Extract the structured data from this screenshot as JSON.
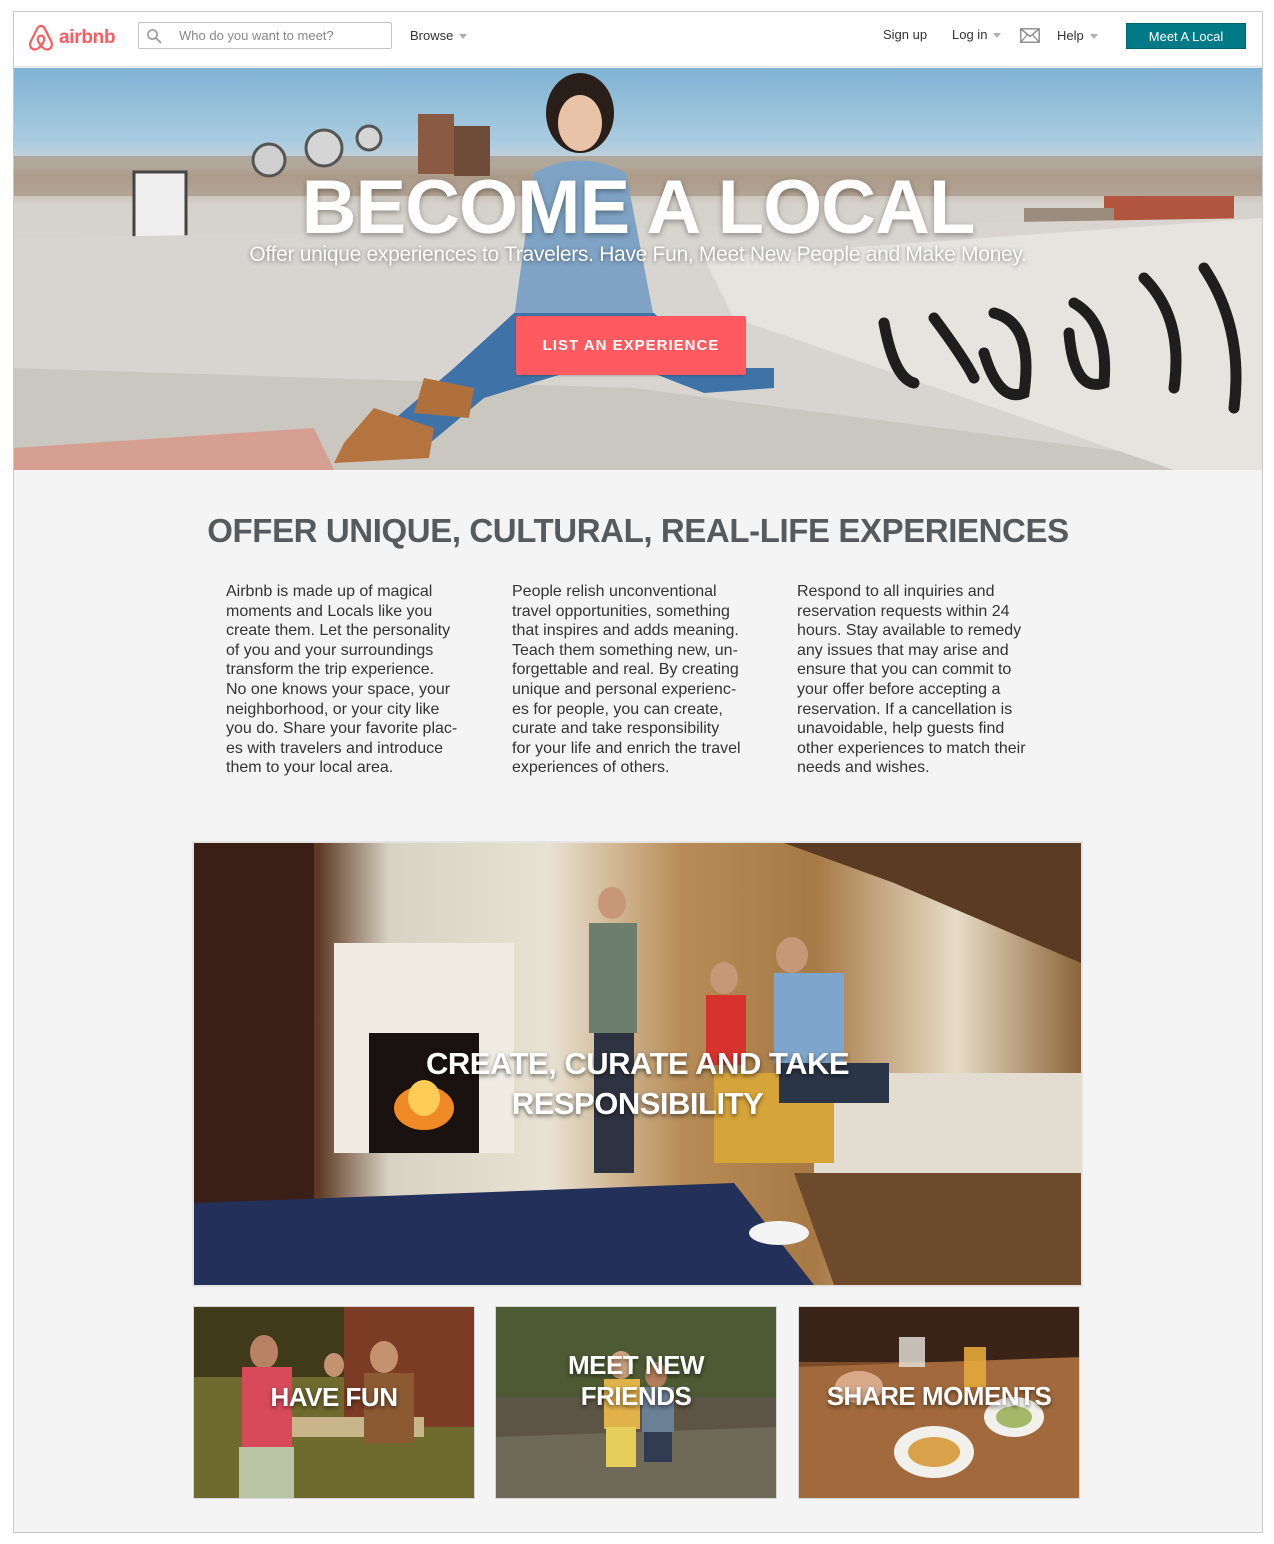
{
  "header": {
    "brand": "airbnb",
    "search": {
      "placeholder": "Who do you want to meet?",
      "value": ""
    },
    "browse_label": "Browse",
    "signup_label": "Sign up",
    "login_label": "Log in",
    "help_label": "Help",
    "cta_label": "Meet A Local",
    "colors": {
      "brand": "#ff5a5f",
      "cta": "#007a87"
    },
    "icons": [
      "airbnb-logo-icon",
      "search-icon",
      "chevron-down-icon",
      "mail-icon"
    ]
  },
  "hero": {
    "title": "BECOME A LOCAL",
    "subtitle": "Offer unique experiences to Travelers. Have Fun, Meet New People and Make Money.",
    "button_label": "LIST AN EXPERIENCE",
    "button_color": "#ff5a5f"
  },
  "intro": {
    "title": "OFFER UNIQUE, CULTURAL, REAL-LIFE EXPERIENCES",
    "columns": [
      "Airbnb is made up of magical\nmoments and Locals like you\ncreate them. Let the personality\nof you and your surroundings\ntransform the trip experience.\nNo one knows your space, your\nneighborhood, or your city like\nyou do. Share your favorite plac-\nes with travelers and introduce\nthem to your local area.",
      "People relish unconventional\ntravel opportunities, something\nthat inspires and adds meaning.\nTeach them something new, un-\nforgettable and real. By creating\nunique and personal experienc-\nes for people, you can create,\ncurate and take responsibility\nfor your life and enrich the travel\nexperiences of others.",
      "Respond to all inquiries and\nreservation requests within 24\nhours. Stay available to remedy\nany issues that may arise and\nensure that you can commit to\nyour offer before accepting a\nreservation. If a cancellation is\nunavoidable, help guests find\nother experiences to match their\nneeds and wishes."
    ]
  },
  "features": {
    "main": "CREATE, CURATE AND TAKE\nRESPONSIBILITY",
    "tiles": [
      "HAVE FUN",
      "MEET NEW\nFRIENDS",
      "SHARE MOMENTS"
    ]
  }
}
